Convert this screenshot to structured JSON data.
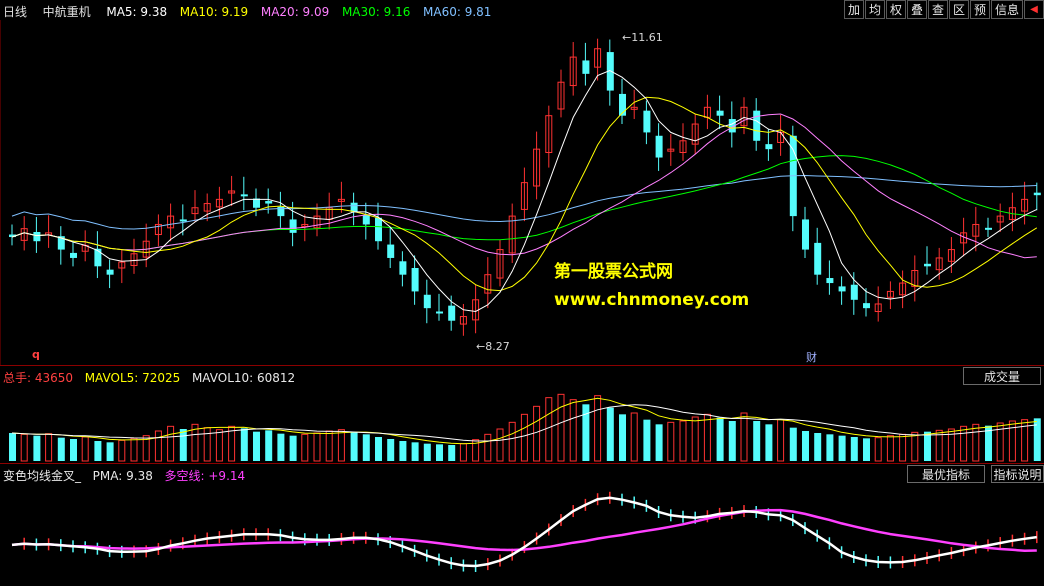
{
  "header": {
    "period": "日线",
    "stock_name": "中航重机",
    "ma": [
      {
        "label": "MA5: 9.38",
        "color": "#ffffff"
      },
      {
        "label": "MA10: 9.19",
        "color": "#ffff00"
      },
      {
        "label": "MA20: 9.09",
        "color": "#ff80ff"
      },
      {
        "label": "MA30: 9.16",
        "color": "#00ff00"
      },
      {
        "label": "MA60: 9.81",
        "color": "#80c0ff"
      }
    ]
  },
  "toolbar": [
    "加",
    "均",
    "权",
    "叠",
    "查",
    "区",
    "预",
    "信息"
  ],
  "price_panel": {
    "high_label": "11.61",
    "low_label": "8.27",
    "marker_left": "q",
    "marker_right": "财",
    "watermark_line1": "第一股票公式网",
    "watermark_line2": "www.chnmoney.com"
  },
  "volume_panel": {
    "label_total": "总手: 43650",
    "label_mavol5": "MAVOL5: 72025",
    "label_mavol10": "MAVOL10: 60812",
    "button": "成交量"
  },
  "indicator_panel": {
    "title": "变色均线金叉_",
    "pma": "PMA: 9.38",
    "dk_label": "多空线:",
    "dk_value": "+9.14",
    "btn_best": "最优指标",
    "btn_help": "指标说明"
  },
  "colors": {
    "up": "#ff3232",
    "down": "#54fcfc",
    "ma5": "#ffffff",
    "ma10": "#ffff00",
    "ma20": "#ff80ff",
    "ma30": "#00ff00",
    "ma60": "#80c0ff",
    "pma_line": "#ff40ff",
    "grid": "#8b0000"
  },
  "chart_data": {
    "type": "candlestick",
    "y_range": [
      8.0,
      11.8
    ],
    "closes": [
      9.35,
      9.45,
      9.3,
      9.4,
      9.2,
      9.1,
      9.25,
      9.0,
      8.9,
      9.05,
      9.15,
      9.3,
      9.5,
      9.6,
      9.55,
      9.7,
      9.75,
      9.8,
      9.9,
      9.85,
      9.7,
      9.75,
      9.6,
      9.4,
      9.5,
      9.6,
      9.7,
      9.8,
      9.65,
      9.5,
      9.3,
      9.1,
      8.9,
      8.7,
      8.5,
      8.45,
      8.35,
      8.4,
      8.6,
      8.9,
      9.2,
      9.6,
      10.0,
      10.4,
      10.8,
      11.2,
      11.5,
      11.3,
      11.6,
      11.1,
      10.8,
      10.9,
      10.6,
      10.3,
      10.4,
      10.5,
      10.7,
      10.9,
      10.8,
      10.6,
      10.9,
      10.5,
      10.4,
      10.6,
      9.6,
      9.2,
      8.9,
      8.8,
      8.7,
      8.6,
      8.5,
      8.55,
      8.7,
      8.8,
      8.95,
      9.0,
      9.1,
      9.2,
      9.4,
      9.5,
      9.45,
      9.6,
      9.7,
      9.8,
      9.85
    ],
    "volumes": [
      42,
      40,
      38,
      41,
      35,
      33,
      36,
      30,
      28,
      31,
      34,
      38,
      45,
      52,
      48,
      55,
      50,
      47,
      52,
      49,
      44,
      46,
      41,
      38,
      40,
      42,
      45,
      47,
      43,
      40,
      36,
      33,
      30,
      28,
      26,
      25,
      24,
      26,
      32,
      40,
      48,
      58,
      70,
      82,
      95,
      100,
      92,
      85,
      98,
      80,
      70,
      72,
      62,
      55,
      58,
      60,
      66,
      70,
      65,
      60,
      72,
      60,
      55,
      62,
      50,
      45,
      42,
      40,
      38,
      36,
      34,
      35,
      38,
      40,
      43,
      44,
      46,
      48,
      52,
      55,
      53,
      57,
      60,
      62,
      64
    ],
    "mavol5": 72025,
    "mavol10": 60812
  }
}
